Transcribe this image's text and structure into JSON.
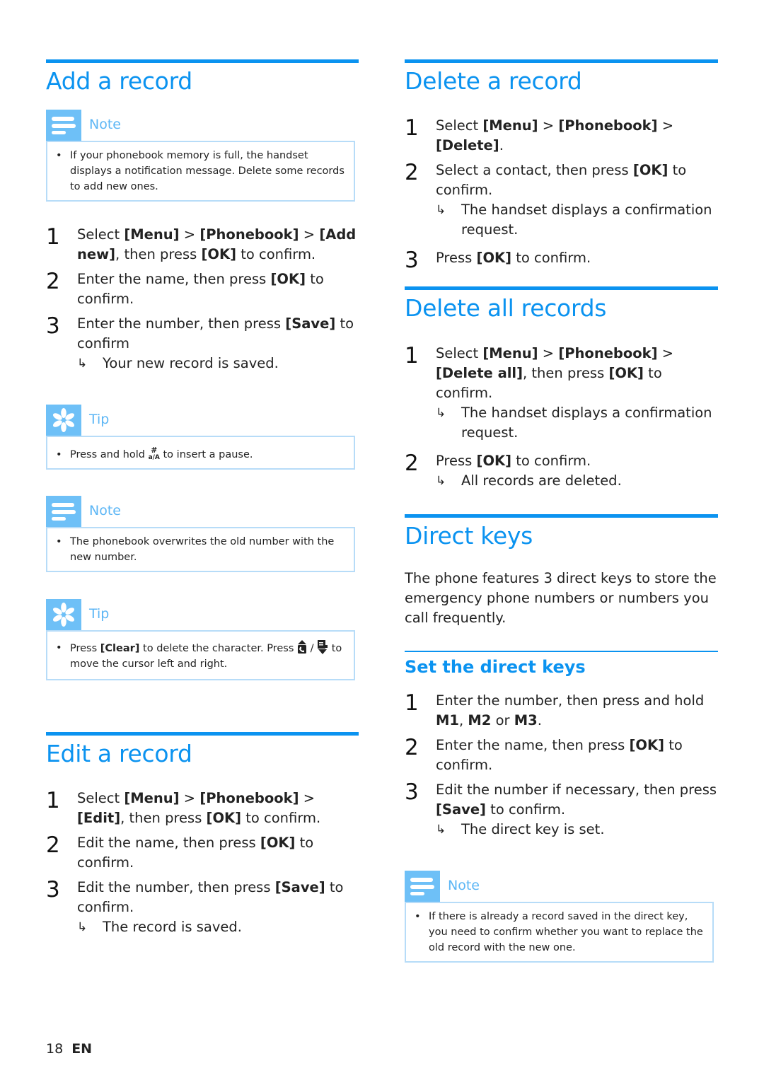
{
  "page": {
    "number": "18",
    "language": "EN"
  },
  "colors": {
    "accent": "#0b93f0",
    "callout_icon_bg": "#6ec0f7",
    "callout_border": "#b7dcf8"
  },
  "add_record": {
    "title": "Add a record",
    "note1": {
      "label": "Note",
      "icon": "note-lines-icon",
      "items": [
        "If your phonebook memory is full, the handset displays a notification message. Delete some records to add new ones."
      ]
    },
    "steps": [
      {
        "num": "1",
        "parts": [
          [
            "Select ",
            false
          ],
          [
            "[Menu]",
            true
          ],
          [
            " > ",
            false
          ],
          [
            "[Phonebook]",
            true
          ],
          [
            " > ",
            false
          ],
          [
            "[Add new]",
            true
          ],
          [
            ", then press ",
            false
          ],
          [
            "[OK]",
            true
          ],
          [
            " to confirm.",
            false
          ]
        ]
      },
      {
        "num": "2",
        "parts": [
          [
            "Enter the name, then press ",
            false
          ],
          [
            "[OK]",
            true
          ],
          [
            " to confirm.",
            false
          ]
        ]
      },
      {
        "num": "3",
        "parts": [
          [
            "Enter the number, then press ",
            false
          ],
          [
            "[Save]",
            true
          ],
          [
            " to confirm",
            false
          ]
        ],
        "result": "Your new record is saved."
      }
    ],
    "tip1": {
      "label": "Tip",
      "icon": "tip-asterisk-icon",
      "text_before": "Press and hold ",
      "key_top": "#",
      "key_bottom": "a/A",
      "text_after": " to insert a pause."
    },
    "note2": {
      "label": "Note",
      "icon": "note-lines-icon",
      "items": [
        "The phonebook overwrites the old number with the new number."
      ]
    },
    "tip2": {
      "label": "Tip",
      "icon": "tip-asterisk-icon",
      "text_before": "Press ",
      "key": "[Clear]",
      "text_mid": " to delete the character. Press ",
      "icon_up": "phonebook-up-icon",
      "separator": " / ",
      "icon_down": "menu-down-icon",
      "text_after": " to move the cursor left and right."
    }
  },
  "edit_record": {
    "title": "Edit a record",
    "steps": [
      {
        "num": "1",
        "parts": [
          [
            "Select ",
            false
          ],
          [
            "[Menu]",
            true
          ],
          [
            " > ",
            false
          ],
          [
            "[Phonebook]",
            true
          ],
          [
            " > ",
            false
          ],
          [
            "[Edit]",
            true
          ],
          [
            ", then press ",
            false
          ],
          [
            "[OK]",
            true
          ],
          [
            " to confirm.",
            false
          ]
        ]
      },
      {
        "num": "2",
        "parts": [
          [
            "Edit the name, then press ",
            false
          ],
          [
            "[OK]",
            true
          ],
          [
            " to confirm.",
            false
          ]
        ]
      },
      {
        "num": "3",
        "parts": [
          [
            "Edit the number, then press ",
            false
          ],
          [
            "[Save]",
            true
          ],
          [
            " to confirm.",
            false
          ]
        ],
        "result": "The record is saved."
      }
    ]
  },
  "delete_record": {
    "title": "Delete a record",
    "steps": [
      {
        "num": "1",
        "parts": [
          [
            "Select ",
            false
          ],
          [
            "[Menu]",
            true
          ],
          [
            " > ",
            false
          ],
          [
            "[Phonebook]",
            true
          ],
          [
            " > ",
            false
          ],
          [
            "[Delete]",
            true
          ],
          [
            ".",
            false
          ]
        ]
      },
      {
        "num": "2",
        "parts": [
          [
            "Select a contact, then press ",
            false
          ],
          [
            "[OK]",
            true
          ],
          [
            " to confirm.",
            false
          ]
        ],
        "result": "The handset displays a confirmation request."
      },
      {
        "num": "3",
        "parts": [
          [
            "Press ",
            false
          ],
          [
            "[OK]",
            true
          ],
          [
            " to confirm.",
            false
          ]
        ]
      }
    ]
  },
  "delete_all": {
    "title": "Delete all records",
    "steps": [
      {
        "num": "1",
        "parts": [
          [
            "Select ",
            false
          ],
          [
            "[Menu]",
            true
          ],
          [
            " > ",
            false
          ],
          [
            "[Phonebook]",
            true
          ],
          [
            " > ",
            false
          ],
          [
            "[Delete all]",
            true
          ],
          [
            ", then press ",
            false
          ],
          [
            "[OK]",
            true
          ],
          [
            " to confirm.",
            false
          ]
        ],
        "result": "The handset displays a confirmation request."
      },
      {
        "num": "2",
        "parts": [
          [
            "Press ",
            false
          ],
          [
            "[OK]",
            true
          ],
          [
            " to confirm.",
            false
          ]
        ],
        "result": "All records are deleted."
      }
    ]
  },
  "direct_keys": {
    "title": "Direct keys",
    "intro": "The phone features 3 direct keys to store the emergency phone numbers or numbers you call frequently.",
    "subsection_title": "Set the direct keys",
    "steps": [
      {
        "num": "1",
        "parts": [
          [
            "Enter the number, then press and hold ",
            false
          ],
          [
            "M1",
            true
          ],
          [
            ", ",
            false
          ],
          [
            "M2",
            true
          ],
          [
            " or ",
            false
          ],
          [
            "M3",
            true
          ],
          [
            ".",
            false
          ]
        ]
      },
      {
        "num": "2",
        "parts": [
          [
            "Enter the name, then press ",
            false
          ],
          [
            "[OK]",
            true
          ],
          [
            " to confirm.",
            false
          ]
        ]
      },
      {
        "num": "3",
        "parts": [
          [
            "Edit the number if necessary, then press ",
            false
          ],
          [
            "[Save]",
            true
          ],
          [
            " to confirm.",
            false
          ]
        ],
        "result": "The direct key is set."
      }
    ],
    "note": {
      "label": "Note",
      "icon": "note-lines-icon",
      "items": [
        "If there is already a record saved in the direct key, you need to confirm whether you want to replace the old record with the new one."
      ]
    }
  }
}
